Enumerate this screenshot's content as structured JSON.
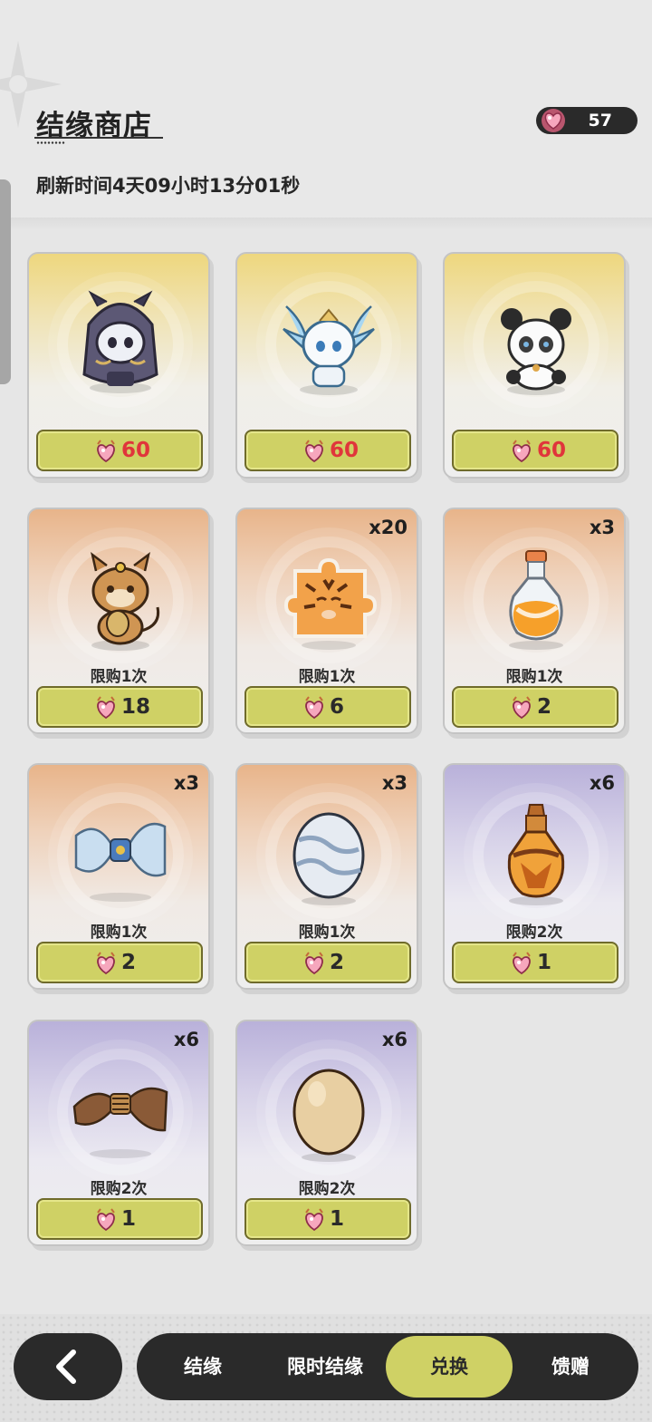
{
  "header": {
    "title": "结缘商店",
    "refresh_text": "刷新时间4天09小时13分01秒",
    "currency_amount": "57"
  },
  "items": [
    {
      "theme": "gold",
      "art": "dark-hooded-creature",
      "qty": "",
      "limit": "",
      "price": "60",
      "price_color": "#e0353b"
    },
    {
      "theme": "gold",
      "art": "white-winged-dragon",
      "qty": "",
      "limit": "",
      "price": "60",
      "price_color": "#e0353b"
    },
    {
      "theme": "gold",
      "art": "panda-creature",
      "qty": "",
      "limit": "",
      "price": "60",
      "price_color": "#e0353b"
    },
    {
      "theme": "orange",
      "art": "lucky-cat-creature",
      "qty": "",
      "limit": "限购1次",
      "price": "18"
    },
    {
      "theme": "orange",
      "art": "tiger-puzzle-piece",
      "qty": "x20",
      "limit": "限购1次",
      "price": "6"
    },
    {
      "theme": "orange",
      "art": "orange-potion",
      "qty": "x3",
      "limit": "限购1次",
      "price": "2"
    },
    {
      "theme": "orange",
      "art": "silk-bundle",
      "qty": "x3",
      "limit": "限购1次",
      "price": "2"
    },
    {
      "theme": "orange",
      "art": "silver-egg",
      "qty": "x3",
      "limit": "限购1次",
      "price": "2"
    },
    {
      "theme": "purple",
      "art": "amber-potion",
      "qty": "x6",
      "limit": "限购2次",
      "price": "1"
    },
    {
      "theme": "purple",
      "art": "straw-bundle",
      "qty": "x6",
      "limit": "限购2次",
      "price": "1"
    },
    {
      "theme": "purple",
      "art": "plain-egg",
      "qty": "x6",
      "limit": "限购2次",
      "price": "1"
    }
  ],
  "nav": {
    "back_icon": "chevron-left-icon",
    "tabs": [
      {
        "label": "结缘",
        "active": false
      },
      {
        "label": "限时结缘",
        "active": false
      },
      {
        "label": "兑换",
        "active": true
      },
      {
        "label": "馈赠",
        "active": false
      }
    ]
  },
  "colors": {
    "accent": "#cfd165",
    "price_red": "#e0353b",
    "dark": "#2a2a2a"
  }
}
